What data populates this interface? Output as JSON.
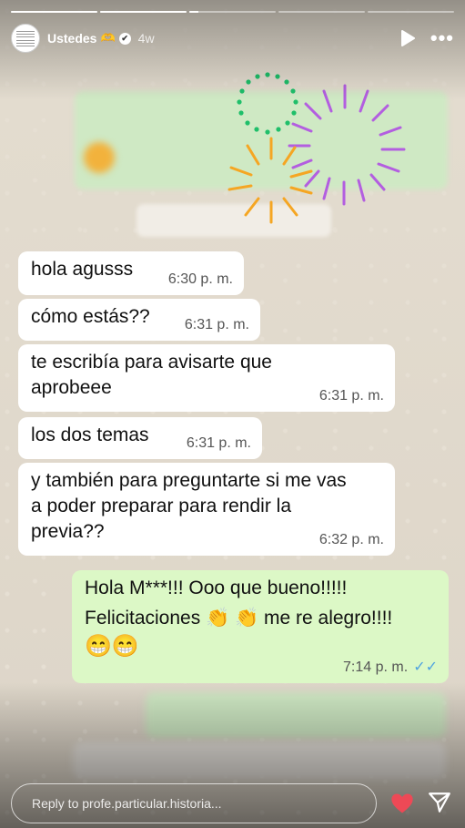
{
  "header": {
    "account_name": "Ustedes",
    "emoji": "🫶",
    "verified_mark": "✔",
    "time_ago": "4w",
    "more_label": "•••"
  },
  "progress": {
    "segments": 5,
    "current": 3,
    "current_fill": 0.1
  },
  "messages": [
    {
      "text": "hola agusss",
      "time": "6:30 p. m."
    },
    {
      "text": "cómo estás??",
      "time": "6:31 p. m."
    },
    {
      "text": "te escribía para avisarte que aprobeee",
      "time": "6:31 p. m."
    },
    {
      "text": "los dos temas",
      "time": "6:31 p. m."
    },
    {
      "text": "y también para preguntarte si me vas a poder preparar para rendir la previa??",
      "time": "6:32 p. m."
    }
  ],
  "reply_message": {
    "line1": "Hola M***!!! Ooo que bueno!!!!!",
    "line2": "Felicitaciones 👏 👏 me re alegro!!!!",
    "line3": "😁😁",
    "time": "7:14 p. m.",
    "ticks": "✓✓"
  },
  "reply_bar": {
    "placeholder": "Reply to profe.particular.historia..."
  },
  "colors": {
    "accent_heart": "#ed4956",
    "bubble_out": "#dcf8c6",
    "bubble_in": "#ffffff",
    "ticks": "#4fa3e0"
  }
}
